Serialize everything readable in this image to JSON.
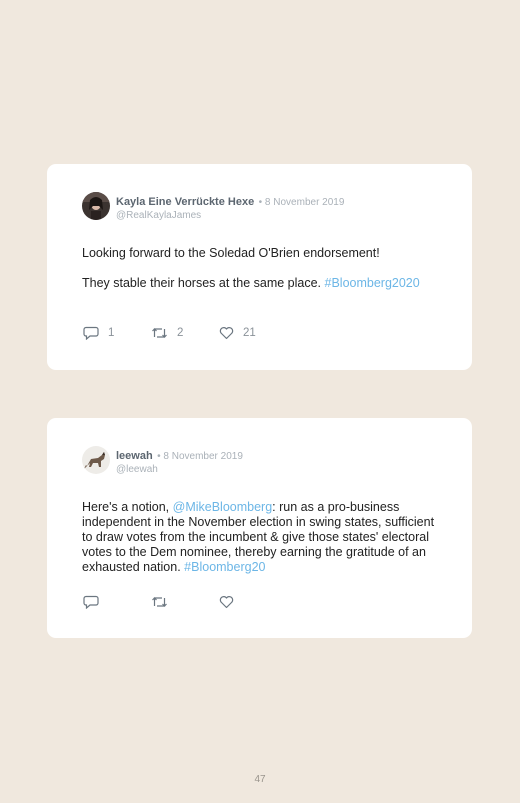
{
  "tweets": [
    {
      "display_name": "Kayla Eine Verrückte Hexe",
      "date": "• 8 November 2019",
      "handle": "@RealKaylaJames",
      "paragraphs": [
        [
          {
            "text": "Looking forward to the Soledad O'Brien endorsement!"
          }
        ],
        [
          {
            "text": "They stable their horses at the same place. "
          },
          {
            "text": "#Bloomberg2020",
            "link": true
          }
        ]
      ],
      "replies": "1",
      "retweets": "2",
      "likes": "21"
    },
    {
      "display_name": "leewah",
      "date": "• 8 November 2019",
      "handle": "@leewah",
      "paragraphs": [
        [
          {
            "text": "Here's a notion, "
          },
          {
            "text": "@MikeBloomberg",
            "link": true
          },
          {
            "text": ": run as a pro-business independent in the November election in swing states, sufficient to draw votes from the incumbent & give those states' electoral votes to the Dem nominee, thereby earning the gratitude of an exhausted nation. "
          },
          {
            "text": "#Bloomberg20",
            "link": true
          }
        ]
      ],
      "replies": "",
      "retweets": "",
      "likes": ""
    }
  ],
  "footer": {
    "page_number": "47"
  },
  "colors": {
    "background": "#f0e8de",
    "card": "#ffffff",
    "link": "#6cb6e6",
    "icon": "#6b7680"
  },
  "icons": [
    "reply-icon",
    "retweet-icon",
    "like-icon"
  ]
}
